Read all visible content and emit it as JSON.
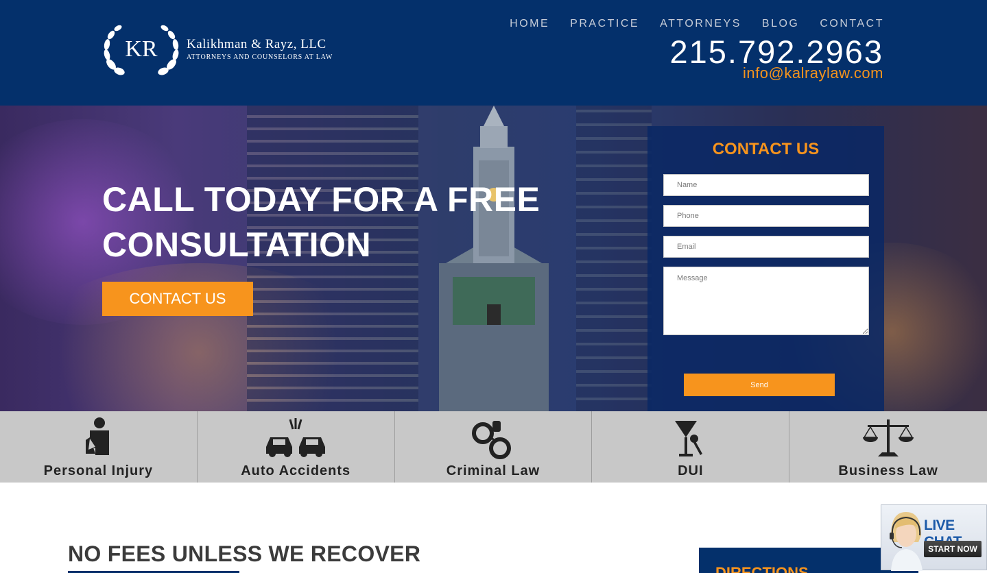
{
  "header": {
    "logo_monogram": "KR",
    "logo_name": "Kalikhman & Rayz, LLC",
    "logo_subtitle": "Attorneys and Counselors at Law",
    "nav": [
      "HOME",
      "PRACTICE",
      "ATTORNEYS",
      "BLOG",
      "CONTACT"
    ],
    "phone": "215.792.2963",
    "email": "info@kalraylaw.com"
  },
  "hero": {
    "title": "CALL TODAY FOR A FREE CONSULTATION",
    "button_label": "CONTACT US"
  },
  "contact_form": {
    "title": "CONTACT US",
    "name_placeholder": "Name",
    "phone_placeholder": "Phone",
    "email_placeholder": "Email",
    "message_placeholder": "Message",
    "send_label": "Send"
  },
  "practice_areas": [
    {
      "label": "Personal Injury",
      "icon": "injured-person-icon"
    },
    {
      "label": "Auto Accidents",
      "icon": "car-crash-icon"
    },
    {
      "label": "Criminal Law",
      "icon": "handcuffs-icon"
    },
    {
      "label": "DUI",
      "icon": "martini-keys-icon"
    },
    {
      "label": "Business Law",
      "icon": "scales-icon"
    }
  ],
  "section": {
    "heading": "NO FEES UNLESS WE RECOVER",
    "directions_label": "DIRECTIONS"
  },
  "live_chat": {
    "title": "LIVE CHAT",
    "button_label": "START NOW"
  },
  "colors": {
    "navy": "#04306b",
    "orange": "#f7941d",
    "practice_bar": "#c8c8c8"
  }
}
